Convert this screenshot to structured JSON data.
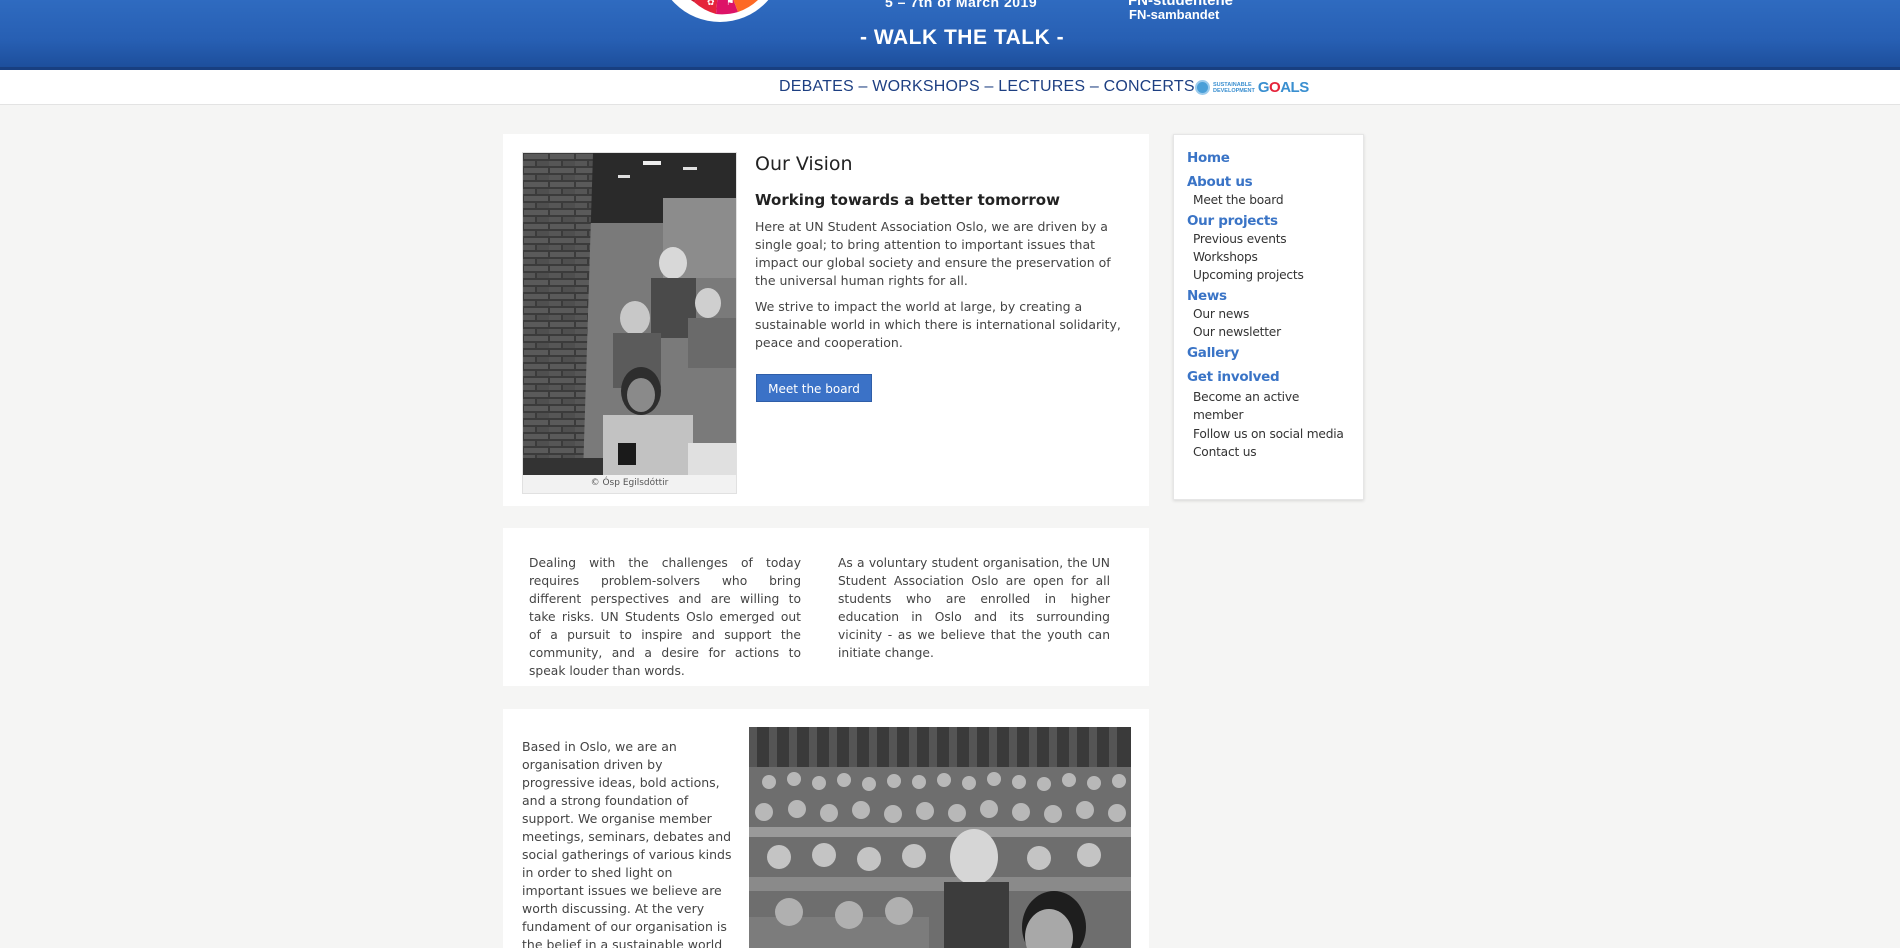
{
  "banner": {
    "date": "5 – 7th of March 2019",
    "slogan": "- WALK THE TALK -",
    "org": "FN-studentene",
    "sub": "FN-sambandet"
  },
  "strip": {
    "activities": "DEBATES – WORKSHOPS – LECTURES – CONCERTS",
    "sdg_small_1": "SUSTAINABLE",
    "sdg_small_2": "DEVELOPMENT",
    "sdg_g": "G",
    "sdg_o": "O",
    "sdg_als": "ALS"
  },
  "vision": {
    "title": "Our Vision",
    "subtitle": "Working towards a better tomorrow",
    "p1": "Here at UN Student Association Oslo, we are driven by a single goal; to bring attention to important issues that impact our global society and ensure the preservation of the universal human rights for all.",
    "p2": "We strive to impact the world at large, by creating a sustainable world in which there is international solidarity, peace and cooperation.",
    "button": "Meet the board",
    "photo_credit": "© Ósp Egilsdóttir"
  },
  "columns": {
    "left": "Dealing with the challenges of today requires problem-solvers who bring different perspectives and are willing to take risks. UN Students Oslo emerged out of a pursuit to inspire and support the community, and a desire for actions to speak louder than words.",
    "right": "As a voluntary student organisation, the UN Student Association Oslo are open for all students who are enrolled in higher education in Oslo and its surrounding vicinity - as we believe that the youth can initiate change."
  },
  "based": {
    "text": "Based in Oslo, we are an organisation driven by progressive ideas, bold actions, and a strong foundation of support. We organise member meetings, seminars, debates and social gatherings of various kinds in order to shed light on important issues we believe are worth discussing. At the very fundament of our organisation is the belief in a sustainable world in which the"
  },
  "sidebar": {
    "home": "Home",
    "about": "About us",
    "meet": "Meet the board",
    "projects": "Our projects",
    "previous": "Previous events",
    "workshops": "Workshops",
    "upcoming": "Upcoming projects",
    "news": "News",
    "our_news": "Our news",
    "newsletter": "Our newsletter",
    "gallery": "Gallery",
    "involved": "Get involved",
    "become": "Become an active member",
    "follow": "Follow us on social media",
    "contact": "Contact us"
  }
}
